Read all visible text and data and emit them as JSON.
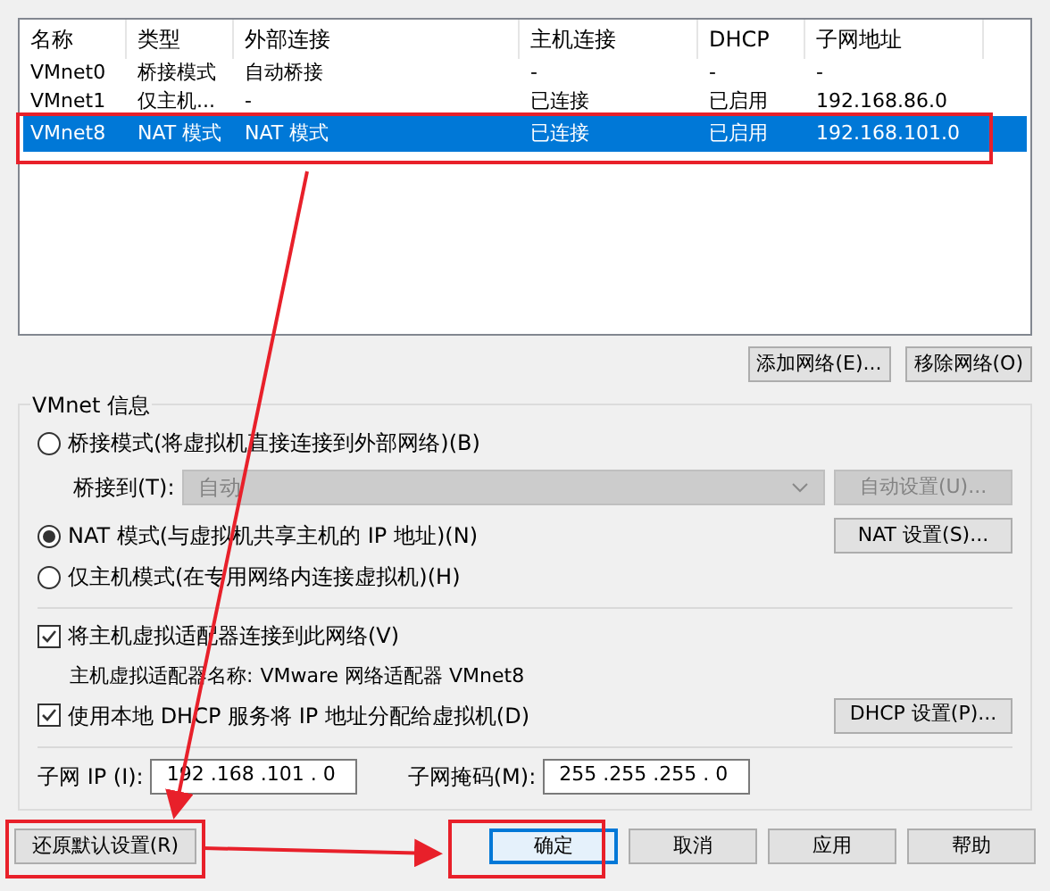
{
  "table": {
    "columns": [
      "名称",
      "类型",
      "外部连接",
      "主机连接",
      "DHCP",
      "子网地址"
    ],
    "rows": [
      {
        "cells": [
          "VMnet0",
          "桥接模式",
          "自动桥接",
          "-",
          "-",
          "-"
        ],
        "selected": false
      },
      {
        "cells": [
          "VMnet1",
          "仅主机...",
          "-",
          "已连接",
          "已启用",
          "192.168.86.0"
        ],
        "selected": false
      },
      {
        "cells": [
          "VMnet8",
          "NAT 模式",
          "NAT 模式",
          "已连接",
          "已启用",
          "192.168.101.0"
        ],
        "selected": true
      }
    ]
  },
  "network_buttons": [
    "添加网络(E)...",
    "移除网络(O)"
  ],
  "vmnet_info": {
    "title": "VMnet 信息",
    "modes": [
      {
        "label": "桥接模式(将虚拟机直接连接到外部网络)(B)",
        "selected": false
      },
      {
        "label": "NAT 模式(与虚拟机共享主机的 IP 地址)(N)",
        "selected": true,
        "button": "NAT 设置(S)..."
      },
      {
        "label": "仅主机模式(在专用网络内连接虚拟机)(H)",
        "selected": false
      }
    ],
    "bridge_to": {
      "label": "桥接到(T):",
      "value": "自动",
      "disabled": true,
      "button": "自动设置(U)..."
    },
    "connect_adapter": {
      "label": "将主机虚拟适配器连接到此网络(V)",
      "checked": true
    },
    "adapter_name": {
      "label": "主机虚拟适配器名称:",
      "value": "VMware 网络适配器 VMnet8"
    },
    "dhcp": {
      "label": "使用本地 DHCP 服务将 IP 地址分配给虚拟机(D)",
      "checked": true,
      "button": "DHCP 设置(P)..."
    },
    "subnet_ip": {
      "label": "子网 IP (I):",
      "value": "192 .168 .101 . 0"
    },
    "subnet_mask": {
      "label": "子网掩码(M):",
      "value": "255 .255 .255 . 0"
    }
  },
  "footer": {
    "restore": "还原默认设置(R)",
    "buttons": [
      {
        "label": "确定",
        "default": true
      },
      {
        "label": "取消",
        "default": false
      },
      {
        "label": "应用",
        "default": false
      },
      {
        "label": "帮助",
        "default": false
      }
    ]
  }
}
